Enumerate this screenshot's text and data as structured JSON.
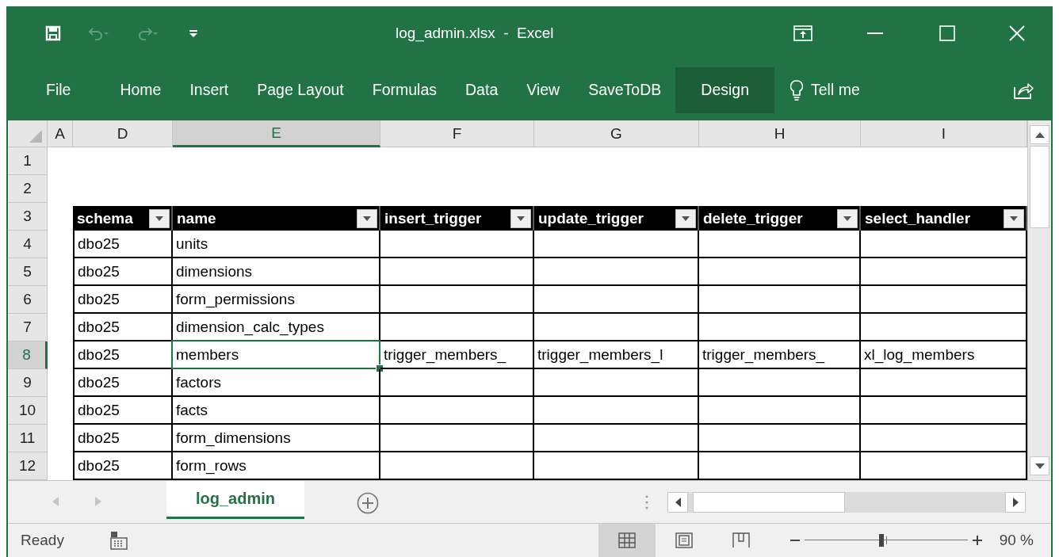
{
  "window": {
    "title": "log_admin.xlsx  -  Excel"
  },
  "quick_access": [
    {
      "kind": "save",
      "disabled": false
    },
    {
      "kind": "undo",
      "disabled": true
    },
    {
      "kind": "redo",
      "disabled": true
    },
    {
      "kind": "customize",
      "disabled": false
    }
  ],
  "ribbon_tabs": [
    {
      "label": "File",
      "selected": false
    },
    {
      "label": "Home",
      "selected": false
    },
    {
      "label": "Insert",
      "selected": false
    },
    {
      "label": "Page Layout",
      "selected": false
    },
    {
      "label": "Formulas",
      "selected": false
    },
    {
      "label": "Data",
      "selected": false
    },
    {
      "label": "View",
      "selected": false
    },
    {
      "label": "SaveToDB",
      "selected": false
    },
    {
      "label": "Design",
      "selected": true
    }
  ],
  "tell_me": "Tell me",
  "column_headers": [
    {
      "label": "A",
      "selected": false
    },
    {
      "label": "D",
      "selected": false
    },
    {
      "label": "E",
      "selected": true
    },
    {
      "label": "F",
      "selected": false
    },
    {
      "label": "G",
      "selected": false
    },
    {
      "label": "H",
      "selected": false
    },
    {
      "label": "I",
      "selected": false
    }
  ],
  "row_headers": [
    {
      "label": "1",
      "selected": false
    },
    {
      "label": "2",
      "selected": false
    },
    {
      "label": "3",
      "selected": false
    },
    {
      "label": "4",
      "selected": false
    },
    {
      "label": "5",
      "selected": false
    },
    {
      "label": "6",
      "selected": false
    },
    {
      "label": "7",
      "selected": false
    },
    {
      "label": "8",
      "selected": true
    },
    {
      "label": "9",
      "selected": false
    },
    {
      "label": "10",
      "selected": false
    },
    {
      "label": "11",
      "selected": false
    },
    {
      "label": "12",
      "selected": false
    }
  ],
  "table": {
    "headers": [
      "schema",
      "name",
      "insert_trigger",
      "update_trigger",
      "delete_trigger",
      "select_handler"
    ],
    "rows": [
      [
        "dbo25",
        "units"
      ],
      [
        "dbo25",
        "dimensions"
      ],
      [
        "dbo25",
        "form_permissions"
      ],
      [
        "dbo25",
        "dimension_calc_types"
      ],
      [
        "dbo25",
        "members",
        "trigger_members_",
        "trigger_members_l",
        "trigger_members_",
        "xl_log_members"
      ],
      [
        "dbo25",
        "factors"
      ],
      [
        "dbo25",
        "facts"
      ],
      [
        "dbo25",
        "form_dimensions"
      ],
      [
        "dbo25",
        "form_rows"
      ]
    ]
  },
  "sheet_tabs": [
    {
      "label": "log_admin",
      "selected": true
    }
  ],
  "status_bar": {
    "text": "Ready",
    "views": [
      {
        "kind": "normal",
        "selected": true
      },
      {
        "kind": "page-layout",
        "selected": false
      },
      {
        "kind": "page-break",
        "selected": false
      }
    ],
    "zoom": {
      "level": 0.47,
      "reading": "90 %"
    }
  }
}
